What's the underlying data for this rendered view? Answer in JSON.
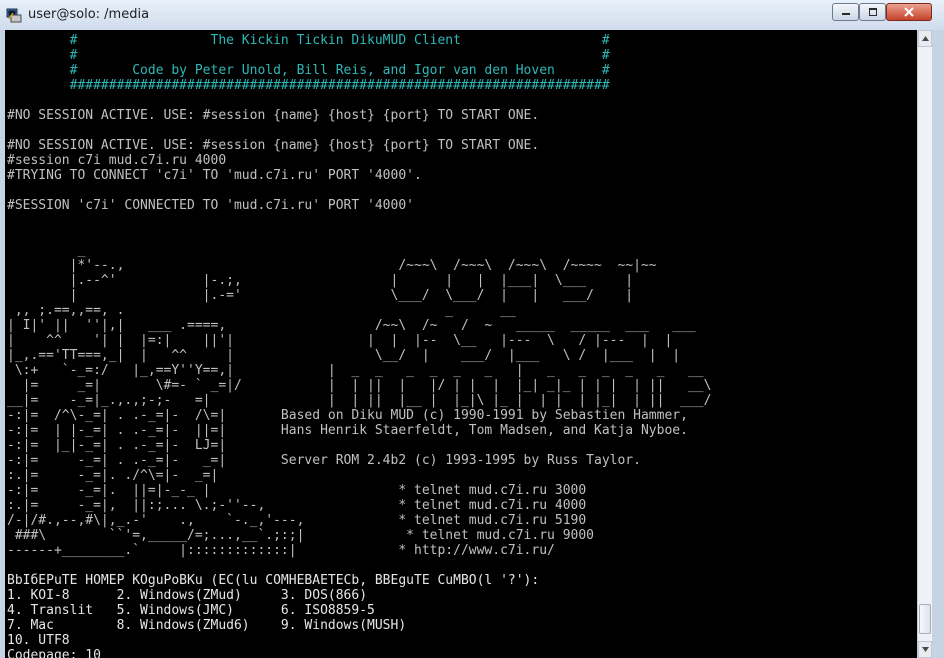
{
  "window": {
    "title": "user@solo: /media",
    "buttons": {
      "minimize": "minimize-icon",
      "maximize": "maximize-icon",
      "close": "close-icon"
    }
  },
  "colors": {
    "background": "#000000",
    "text": "#c0c0c0",
    "banner": "#2fb7b7",
    "titlebar": "#d6e2f0"
  },
  "terminal": {
    "lines": [
      {
        "text": "        #                 The Kickin Tickin DikuMUD Client                  #",
        "style": "cyan"
      },
      {
        "text": "        #                                                                   #",
        "style": "cyan"
      },
      {
        "text": "        #       Code by Peter Unold, Bill Reis, and Igor van den Hoven      #",
        "style": "cyan"
      },
      {
        "text": "        #####################################################################",
        "style": "cyan"
      },
      {
        "text": "",
        "style": "gray"
      },
      {
        "text": "#NO SESSION ACTIVE. USE: #session {name} {host} {port} TO START ONE.",
        "style": "gray"
      },
      {
        "text": "",
        "style": "gray"
      },
      {
        "text": "#NO SESSION ACTIVE. USE: #session {name} {host} {port} TO START ONE.",
        "style": "gray"
      },
      {
        "text": "#session c7i mud.c7i.ru 4000",
        "style": "gray"
      },
      {
        "text": "#TRYING TO CONNECT 'c7i' TO 'mud.c7i.ru' PORT '4000'.",
        "style": "gray"
      },
      {
        "text": "",
        "style": "gray"
      },
      {
        "text": "#SESSION 'c7i' CONNECTED TO 'mud.c7i.ru' PORT '4000'",
        "style": "gray"
      },
      {
        "text": "",
        "style": "gray"
      },
      {
        "text": "",
        "style": "gray"
      },
      {
        "text": "         _",
        "style": "gray"
      },
      {
        "text": "        |*'--.,                                   /~~~\\  /~~~\\  /~~~\\  /~~~~  ~~|~~",
        "style": "gray"
      },
      {
        "text": "        |.--^'           |-.;,                   |      |   |  |___|  \\___     |",
        "style": "gray"
      },
      {
        "text": "        |                |.-='                   \\___/  \\___/  |   |   ___/    |",
        "style": "gray"
      },
      {
        "text": " ,, ;.==,,==, .                                         _      __",
        "style": "gray"
      },
      {
        "text": "| I|' ||  ''|,|   ___ .====,                   /~~\\  /~   /  ~   _____  _____  ___   ___",
        "style": "gray"
      },
      {
        "text": "|    ^^    '| |  |=:|    ||'|                 |  |  |--  \\__   |---  \\   / |---  |  |",
        "style": "gray"
      },
      {
        "text": "|_,.=='TT===,_|  |   ^^     |                  \\__/  |    ___/  |___   \\ /  |___  |  |",
        "style": "gray"
      },
      {
        "text": " \\:+   `-_=:/   |_,==Y''Y==,|            |  _  _   _  _  _   _   |   _   _  _  _   _   __",
        "style": "gray"
      },
      {
        "text": "  |=     _=|       \\#=- ` _=|/           |  | ||  |   |/ | |  |  |_| _|_ | | |  | ||   __\\",
        "style": "gray"
      },
      {
        "text": "__|=    -_=|_.,.,;-;-   =|               |  | ||  |__ |  |_|\\ |_ |  | |  | |_|  | ||  ___/",
        "style": "gray"
      },
      {
        "text": "-:|=  /^\\-_=| . .-_=|-  /\\=|       Based on Diku MUD (c) 1990-1991 by Sebastien Hammer,",
        "style": "gray"
      },
      {
        "text": "-:|=  | |-_=| . .-_=|-  ||=|       Hans Henrik Staerfeldt, Tom Madsen, and Katja Nyboe.",
        "style": "gray"
      },
      {
        "text": "-:|=  |_|-_=| . .-_=|-  LJ=|",
        "style": "gray"
      },
      {
        "text": "-:|=     -_=| . .-_=|-   _=|       Server ROM 2.4b2 (c) 1993-1995 by Russ Taylor.",
        "style": "gray"
      },
      {
        "text": ":.|=     -_=|. ./^\\=|-  _=|",
        "style": "gray"
      },
      {
        "text": "-:|=     -_=|.  ||=|-_-_ |                        * telnet mud.c7i.ru 3000",
        "style": "gray"
      },
      {
        "text": ":.|=     -_=|,  ||:;... \\.;-''--,                 * telnet mud.c7i.ru 4000",
        "style": "gray"
      },
      {
        "text": "/-|/#.,--,#\\|,_.-'    .,    `-._,'---,            * telnet mud.c7i.ru 5190",
        "style": "gray"
      },
      {
        "text": " ###\\        ``'=,_____/=;...,__`.;:;|             * telnet mud.c7i.ru 9000",
        "style": "gray"
      },
      {
        "text": "------+________.`     |:::::::::::::|             * http://www.c7i.ru/",
        "style": "gray"
      },
      {
        "text": "",
        "style": "gray"
      },
      {
        "text": "BbIбEPuTE HOMEP KOguPoBKu (EC(lu COMHEBAETECb, BBEguTE CuMBO(l '?'):",
        "style": "white"
      },
      {
        "text": "1. KOI-8      2. Windows(ZMud)     3. DOS(866)",
        "style": "white"
      },
      {
        "text": "4. Translit   5. Windows(JMC)      6. ISO8859-5",
        "style": "white"
      },
      {
        "text": "7. Mac        8. Windows(ZMud6)    9. Windows(MUSH)",
        "style": "white"
      },
      {
        "text": "10. UTF8",
        "style": "white"
      },
      {
        "text": "Codepage: 10",
        "style": "white"
      }
    ]
  },
  "scrollbar": {
    "position": 0.95
  }
}
